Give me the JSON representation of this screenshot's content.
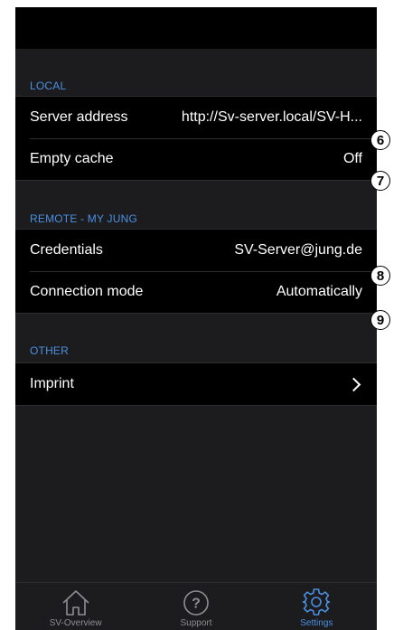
{
  "sections": {
    "local": {
      "header": "LOCAL",
      "rows": [
        {
          "label": "Server address",
          "value": "http://Sv-server.local/SV-H..."
        },
        {
          "label": "Empty cache",
          "value": "Off"
        }
      ]
    },
    "remote": {
      "header": "REMOTE - MY JUNG",
      "rows": [
        {
          "label": "Credentials",
          "value": "SV-Server@jung.de"
        },
        {
          "label": "Connection mode",
          "value": "Automatically"
        }
      ]
    },
    "other": {
      "header": "OTHER",
      "rows": [
        {
          "label": "Imprint",
          "icon": "chevron-right-icon"
        }
      ]
    }
  },
  "callouts": [
    "6",
    "7",
    "8",
    "9"
  ],
  "tab_bar": {
    "tabs": [
      {
        "label": "SV-Overview",
        "icon": "home-icon",
        "active": false
      },
      {
        "label": "Support",
        "icon": "question-circle-icon",
        "active": false
      },
      {
        "label": "Settings",
        "icon": "gear-icon",
        "active": true
      }
    ]
  },
  "colors": {
    "accent": "#4a90e2",
    "background": "#1c1c1e",
    "cell": "#000000",
    "inactive_tab": "#8e8e93"
  }
}
